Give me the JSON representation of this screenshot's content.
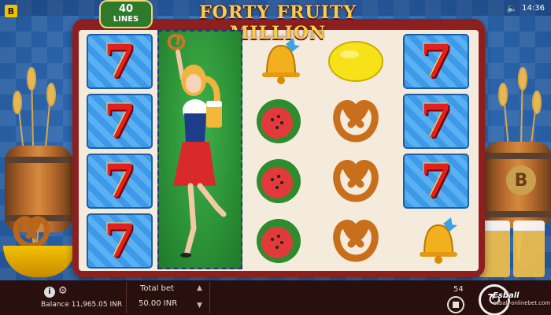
{
  "game": {
    "title": "FORTY FRUITY MILLION",
    "lines_count": "40",
    "lines_label": "LINES"
  },
  "status_bar": {
    "time": "14:36",
    "provider_logo": "B"
  },
  "reels": [
    [
      "seven",
      "seven",
      "seven",
      "seven"
    ],
    [
      "wild-girl",
      "wild-girl",
      "wild-girl",
      "wild-girl"
    ],
    [
      "bell",
      "watermelon",
      "watermelon",
      "watermelon"
    ],
    [
      "lemon",
      "pretzel",
      "pretzel",
      "pretzel"
    ],
    [
      "seven",
      "seven",
      "seven",
      "bell"
    ]
  ],
  "seven_glyph": "7",
  "bottom_bar": {
    "balance_label": "Balance",
    "balance_value": "11,965.05 INR",
    "total_bet_label": "Total bet",
    "total_bet_value": "50.00 INR",
    "spin_count": "54",
    "watermark_brand": "Esball",
    "watermark_url": "esball-onlinebet.com"
  },
  "colors": {
    "frame": "#8e1f1f",
    "title": "#f6d04a",
    "seven_red": "#e32020",
    "tile_blue": "#3d9ae8",
    "wild_green": "#2f9a3a"
  }
}
